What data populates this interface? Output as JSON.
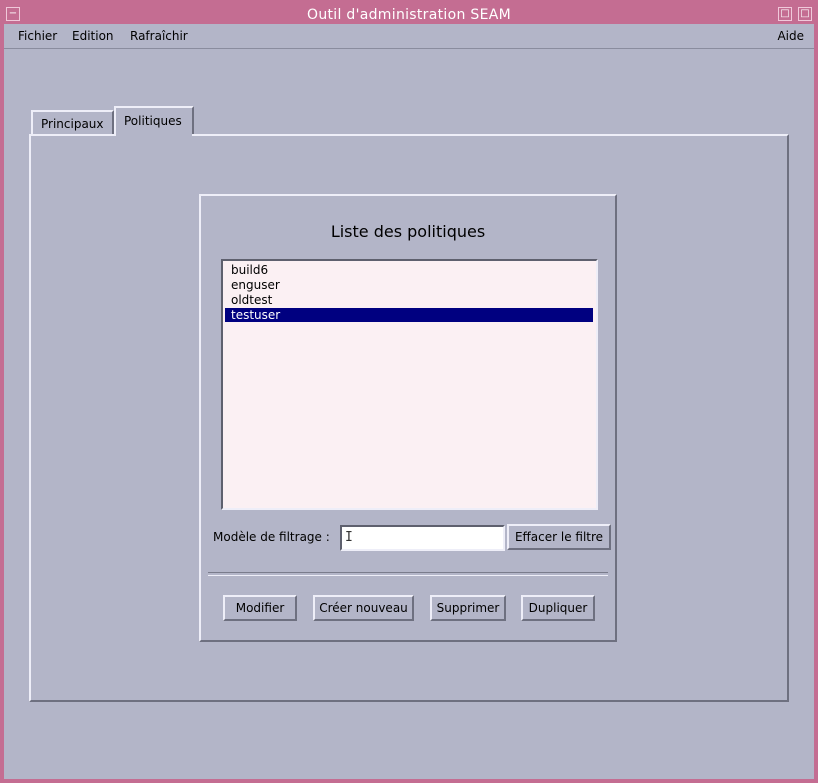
{
  "window": {
    "title": "Outil d'administration SEAM",
    "minimize_glyph": "□",
    "close_glyph": "□",
    "menu_glyph": "−"
  },
  "menu": {
    "file": "Fichier",
    "edit": "Edition",
    "refresh": "Rafraîchir",
    "help": "Aide"
  },
  "tabs": [
    {
      "label": "Principaux"
    },
    {
      "label": "Politiques"
    }
  ],
  "policies": {
    "heading": "Liste des politiques",
    "items": [
      {
        "label": "build6",
        "selected": false
      },
      {
        "label": "enguser",
        "selected": false
      },
      {
        "label": "oldtest",
        "selected": false
      },
      {
        "label": "testuser",
        "selected": true
      }
    ],
    "filter_label": "Modèle de filtrage :",
    "filter_value": "",
    "filter_cursor": "I",
    "clear_filter": "Effacer le filtre",
    "buttons": {
      "modify": "Modifier",
      "create": "Créer nouveau",
      "delete": "Supprimer",
      "duplicate": "Dupliquer"
    }
  },
  "colors": {
    "title_bar": "#c46d92",
    "background": "#b3b5c8",
    "list_background": "#fbf0f3",
    "selection": "#000080"
  }
}
